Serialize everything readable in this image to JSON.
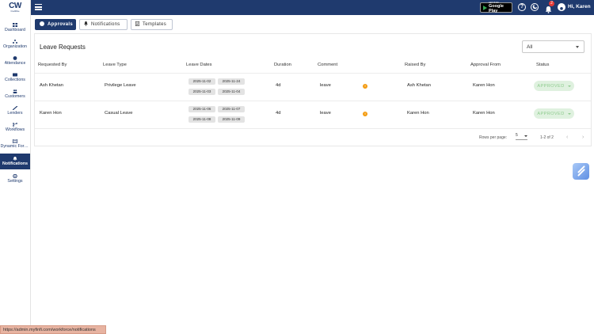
{
  "brand": {
    "logo_text": "CW",
    "logo_sub": "CredWise"
  },
  "header": {
    "play_small": "GET IT ON",
    "play_big": "Google Play",
    "notification_count": "2",
    "greeting": "Hi, Karen"
  },
  "sidebar": {
    "items": [
      {
        "label": "Dashboard",
        "icon": "dashboard-icon",
        "active": false
      },
      {
        "label": "Organization",
        "icon": "organization-icon",
        "active": false
      },
      {
        "label": "Attendance",
        "icon": "attendance-icon",
        "active": false
      },
      {
        "label": "Collections",
        "icon": "collections-icon",
        "active": false
      },
      {
        "label": "Customers",
        "icon": "customers-icon",
        "active": false
      },
      {
        "label": "Lenders",
        "icon": "lenders-icon",
        "active": false
      },
      {
        "label": "Workflows",
        "icon": "workflows-icon",
        "active": false
      },
      {
        "label": "Dynamic Forms",
        "icon": "forms-icon",
        "active": false
      },
      {
        "label": "Notifications",
        "icon": "notifications-icon",
        "active": true
      },
      {
        "label": "Settings",
        "icon": "settings-icon",
        "active": false
      }
    ]
  },
  "tabs": [
    {
      "label": "Approvals",
      "icon": "approvals-icon",
      "active": true
    },
    {
      "label": "Notifications",
      "icon": "bell-icon",
      "active": false
    },
    {
      "label": "Templates",
      "icon": "templates-icon",
      "active": false
    }
  ],
  "card": {
    "title": "Leave Requests",
    "filter_value": "All"
  },
  "table": {
    "headers": [
      "Requested By",
      "Leave Type",
      "Leave Dates",
      "Duration",
      "Comment",
      "Raised By",
      "Approval From",
      "Status"
    ],
    "rows": [
      {
        "requested_by": "Ash Khetan",
        "leave_type": "Privilege Leave",
        "dates": [
          "2025-11-02",
          "2025-11-24",
          "2025-11-03",
          "2025-11-04"
        ],
        "duration": "4d",
        "comment": "leave",
        "info": "!",
        "raised_by": "Ash Khetan",
        "approval_from": "Karen Hon",
        "status": "APPROVED"
      },
      {
        "requested_by": "Karen Hon",
        "leave_type": "Casual Leave",
        "dates": [
          "2025-11-06",
          "2025-11-07",
          "2025-11-08",
          "2025-11-09"
        ],
        "duration": "4d",
        "comment": "leave",
        "info": "!",
        "raised_by": "Karen Hon",
        "approval_from": "Karen Hon",
        "status": "APPROVED"
      }
    ]
  },
  "pagination": {
    "rows_label": "Rows per page:",
    "rows_value": "5",
    "range": "1-2 of 2",
    "prev": "‹",
    "next": "›"
  },
  "statusbar": {
    "url": "https://admin.myfinfi.com/workforce/notifications"
  },
  "colors": {
    "primary": "#1f3a6e",
    "approved_bg": "#dff1df",
    "approved_text": "#8fcc8f",
    "info_dot": "#f39c12"
  }
}
